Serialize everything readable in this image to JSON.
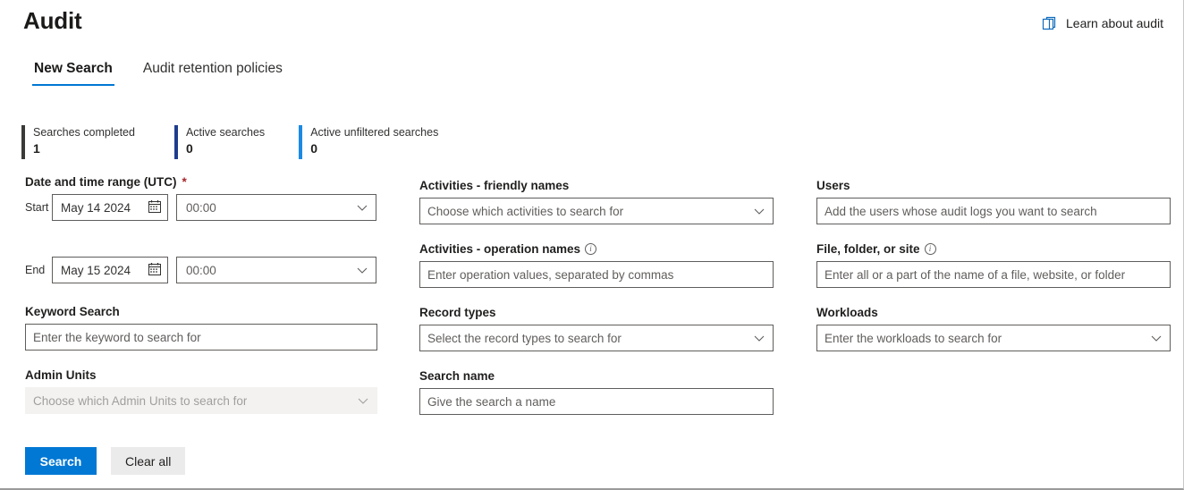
{
  "header": {
    "title": "Audit",
    "learn_link": "Learn about audit",
    "learn_icon": "copy-pages-icon"
  },
  "tabs": [
    {
      "label": "New Search",
      "active": true
    },
    {
      "label": "Audit retention policies",
      "active": false
    }
  ],
  "stats": [
    {
      "label": "Searches completed",
      "value": "1",
      "color": "#3b3a39"
    },
    {
      "label": "Active searches",
      "value": "0",
      "color": "#1f3d8c"
    },
    {
      "label": "Active unfiltered searches",
      "value": "0",
      "color": "#1a8ae5"
    }
  ],
  "form": {
    "date_range": {
      "label": "Date and time range (UTC)",
      "required_marker": "*",
      "start_label": "Start",
      "start_date": "May 14 2024",
      "start_time": "00:00",
      "end_label": "End",
      "end_date": "May 15 2024",
      "end_time": "00:00",
      "calendar_icon": "calendar-icon"
    },
    "keyword_search": {
      "label": "Keyword Search",
      "placeholder": "Enter the keyword to search for"
    },
    "admin_units": {
      "label": "Admin Units",
      "placeholder": "Choose which Admin Units to search for",
      "disabled": true
    },
    "activities_friendly": {
      "label": "Activities - friendly names",
      "placeholder": "Choose which activities to search for"
    },
    "activities_operation": {
      "label": "Activities - operation names",
      "info": "i",
      "placeholder": "Enter operation values, separated by commas"
    },
    "record_types": {
      "label": "Record types",
      "placeholder": "Select the record types to search for"
    },
    "search_name": {
      "label": "Search name",
      "placeholder": "Give the search a name"
    },
    "users": {
      "label": "Users",
      "placeholder": "Add the users whose audit logs you want to search"
    },
    "file_folder_site": {
      "label": "File, folder, or site",
      "info": "i",
      "placeholder": "Enter all or a part of the name of a file, website, or folder"
    },
    "workloads": {
      "label": "Workloads",
      "placeholder": "Enter the workloads to search for"
    }
  },
  "actions": {
    "search_label": "Search",
    "clear_label": "Clear all",
    "primary_color": "#0078d4"
  }
}
